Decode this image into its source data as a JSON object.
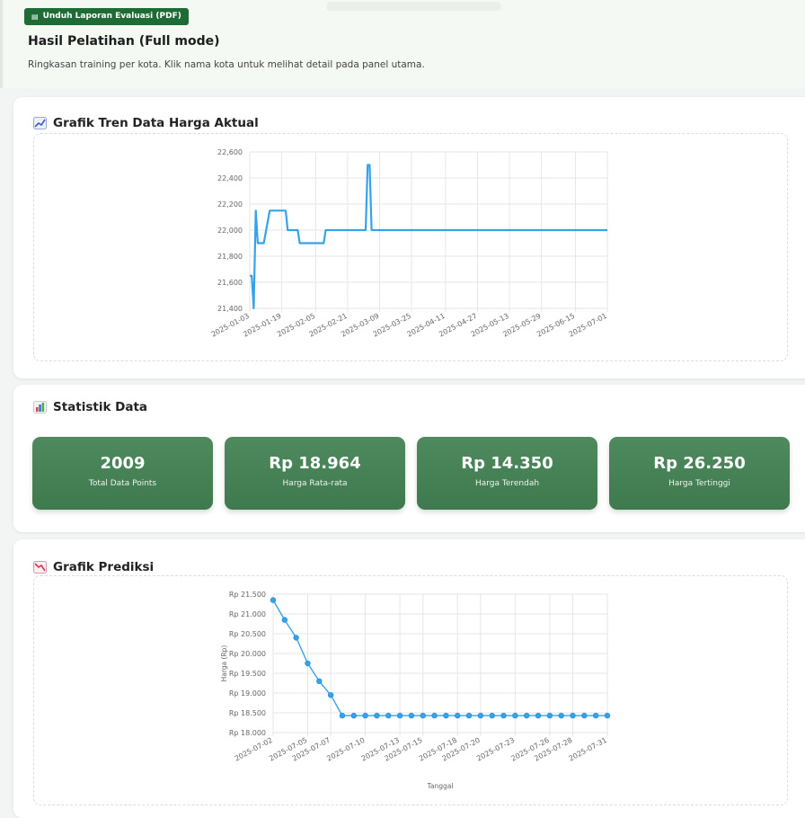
{
  "header": {
    "pdf_button_label": "Unduh Laporan Evaluasi (PDF)",
    "title": "Hasil Pelatihan (Full mode)",
    "subtitle": "Ringkasan training per kota. Klik nama kota untuk melihat detail pada panel utama."
  },
  "trend_section": {
    "title": "Grafik Tren Data Harga Aktual",
    "icon": "chart-up-icon"
  },
  "stats_section": {
    "title": "Statistik Data",
    "icon": "bar-chart-icon",
    "cards": [
      {
        "value": "2009",
        "label": "Total Data Points"
      },
      {
        "value": "Rp 18.964",
        "label": "Harga Rata-rata"
      },
      {
        "value": "Rp 14.350",
        "label": "Harga Terendah"
      },
      {
        "value": "Rp 26.250",
        "label": "Harga Tertinggi"
      }
    ],
    "card_color": "#4a855a"
  },
  "prediction_section": {
    "title": "Grafik Prediksi",
    "icon": "chart-down-icon"
  },
  "chart_data": [
    {
      "type": "line",
      "title": "",
      "xlabel": "",
      "ylabel": "",
      "ylim": [
        21400,
        22600
      ],
      "yticks": [
        "21,400",
        "21,600",
        "21,800",
        "22,000",
        "22,200",
        "22,400",
        "22,600"
      ],
      "xticks": [
        "2025-01-03",
        "2025-01-19",
        "2025-02-05",
        "2025-02-21",
        "2025-03-09",
        "2025-03-25",
        "2025-04-11",
        "2025-04-27",
        "2025-05-13",
        "2025-05-29",
        "2025-06-15",
        "2025-07-01"
      ],
      "grid": true,
      "color": "#36a2eb",
      "series": [
        {
          "x": [
            "2025-01-03",
            "2025-01-04",
            "2025-01-05",
            "2025-01-06",
            "2025-01-07",
            "2025-01-08",
            "2025-01-10",
            "2025-01-13",
            "2025-01-14",
            "2025-01-21",
            "2025-01-22",
            "2025-01-27",
            "2025-01-28",
            "2025-02-09",
            "2025-02-10",
            "2025-02-23",
            "2025-03-02",
            "2025-03-03",
            "2025-03-04",
            "2025-03-05",
            "2025-03-06",
            "2025-07-01"
          ],
          "values": [
            21650,
            21650,
            21400,
            22150,
            21900,
            21900,
            21900,
            22150,
            22150,
            22150,
            22000,
            22000,
            21900,
            21900,
            22000,
            22000,
            22000,
            22500,
            22500,
            22000,
            22000,
            22000
          ]
        }
      ]
    },
    {
      "type": "line",
      "title": "",
      "xlabel": "Tanggal",
      "ylabel": "Harga (Rp)",
      "ylim": [
        18000,
        21500
      ],
      "yticks": [
        "Rp 18.000",
        "Rp 18.500",
        "Rp 19.000",
        "Rp 19.500",
        "Rp 20.000",
        "Rp 20.500",
        "Rp 21.000",
        "Rp 21.500"
      ],
      "xticks": [
        "2025-07-02",
        "2025-07-05",
        "2025-07-07",
        "2025-07-10",
        "2025-07-13",
        "2025-07-15",
        "2025-07-18",
        "2025-07-20",
        "2025-07-23",
        "2025-07-26",
        "2025-07-28",
        "2025-07-31"
      ],
      "grid": true,
      "color": "#36a2eb",
      "series": [
        {
          "x": [
            "2025-07-02",
            "2025-07-03",
            "2025-07-04",
            "2025-07-05",
            "2025-07-06",
            "2025-07-07",
            "2025-07-08",
            "2025-07-09",
            "2025-07-10",
            "2025-07-11",
            "2025-07-12",
            "2025-07-13",
            "2025-07-14",
            "2025-07-15",
            "2025-07-16",
            "2025-07-17",
            "2025-07-18",
            "2025-07-19",
            "2025-07-20",
            "2025-07-21",
            "2025-07-22",
            "2025-07-23",
            "2025-07-24",
            "2025-07-25",
            "2025-07-26",
            "2025-07-27",
            "2025-07-28",
            "2025-07-29",
            "2025-07-30",
            "2025-07-31"
          ],
          "values": [
            21350,
            20850,
            20400,
            19750,
            19300,
            18950,
            18430,
            18430,
            18430,
            18430,
            18430,
            18430,
            18430,
            18430,
            18430,
            18430,
            18430,
            18430,
            18430,
            18430,
            18430,
            18430,
            18430,
            18430,
            18430,
            18430,
            18430,
            18430,
            18430,
            18430
          ]
        }
      ]
    }
  ]
}
